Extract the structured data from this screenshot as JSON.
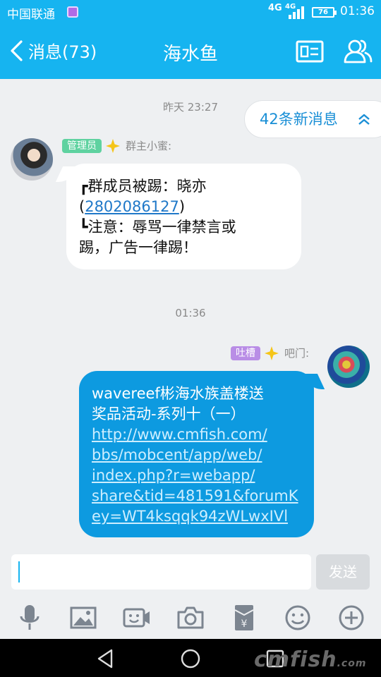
{
  "status_bar": {
    "carrier": "中国联通",
    "network": "4G",
    "network2": "4G",
    "battery": "76",
    "time": "01:36"
  },
  "header": {
    "back_label": "消息(73)",
    "title": "海水鱼",
    "icons": [
      "profile-card-icon",
      "group-members-icon"
    ]
  },
  "chat": {
    "timestamp_1": "昨天 23:27",
    "new_messages": "42条新消息",
    "messages": [
      {
        "badge": "管理员",
        "sender": "群主小蜜:",
        "lines": [
          "┏群成员被踢：晓亦",
          "(",
          "2802086127",
          ")",
          "┗注意：辱骂一律禁言或",
          "踢，广告一律踢！"
        ]
      },
      {
        "badge": "吐槽",
        "sender": "吧门:",
        "lines": [
          "wavereef彬海水族盖楼送",
          "奖品活动-系列十（一）"
        ],
        "url_lines": [
          "http://www.cmfish.com/",
          "bbs/mobcent/app/web/",
          "index.php?r=webapp/",
          "share&tid=481591&forumK",
          "ey=WT4ksqqk94zWLwxIVl"
        ]
      }
    ],
    "timestamp_2": "01:36"
  },
  "input": {
    "value": "",
    "send_label": "发送"
  },
  "toolbar": {
    "icons": [
      "microphone-icon",
      "image-icon",
      "video-icon",
      "camera-icon",
      "red-envelope-icon",
      "emoji-icon",
      "plus-icon"
    ]
  },
  "watermark": {
    "text": "cmfish",
    "suffix": ".com"
  },
  "colors": {
    "accent": "#16b4f0",
    "outgoing_bubble": "#0d9ae0",
    "admin_tag": "#5fd2a0",
    "tucao_tag": "#b98de6"
  }
}
